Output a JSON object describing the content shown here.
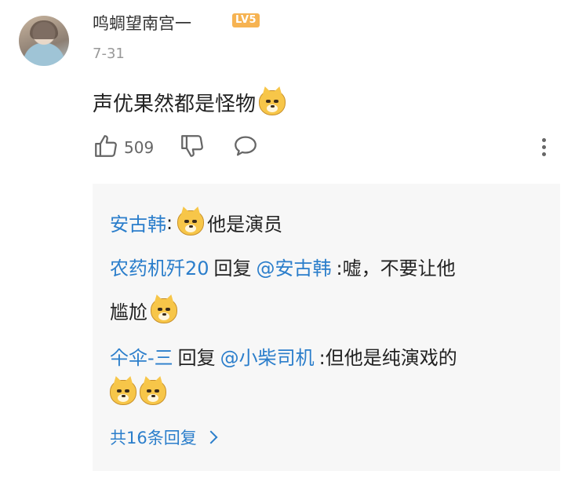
{
  "comment": {
    "username": "鸣蜩望南宫一",
    "level_badge": "LV5",
    "date": "7-31",
    "text": "声优果然都是怪物",
    "emoji_name": "doge-emoji",
    "likes": "509"
  },
  "replies": [
    {
      "user": "安古韩",
      "separator": ":",
      "text": "他是演员"
    },
    {
      "user": "农药机歼20",
      "verb": "回复",
      "mention": "@安古韩",
      "text_line1": ":嘘，不要让他",
      "text_line2": "尴尬"
    },
    {
      "user": "仐伞-三",
      "verb": "回复",
      "mention": "@小柴司机",
      "text": ":但他是纯演戏的"
    }
  ],
  "more_replies_label": "共16条回复",
  "icons": {
    "like": "thumbs-up-icon",
    "dislike": "thumbs-down-icon",
    "reply": "chat-bubble-icon",
    "more": "more-vertical-icon"
  },
  "colors": {
    "link_blue": "#2b7ecb",
    "level_badge": "#f6b352",
    "reply_background": "#f7f7f7"
  }
}
